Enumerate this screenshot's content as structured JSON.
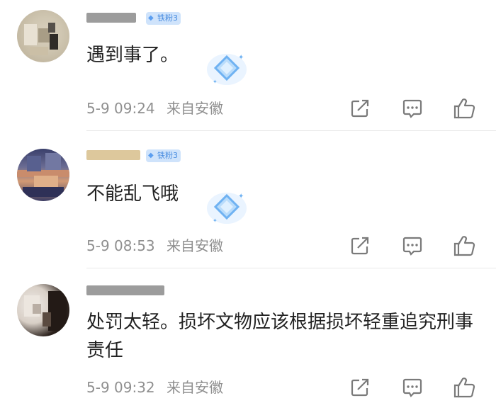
{
  "comments": [
    {
      "username": "",
      "fan_badge": "铁粉3",
      "text": "遇到事了。",
      "date": "5-9 09:24",
      "location": "来自安徽",
      "has_sticker": true
    },
    {
      "username": "",
      "fan_badge": "铁粉3",
      "text": "不能乱飞哦",
      "date": "5-9 08:53",
      "location": "来自安徽",
      "has_sticker": true
    },
    {
      "username": "",
      "fan_badge": "",
      "text": "处罚太轻。损坏文物应该根据损坏轻重追究刑事责任",
      "date": "5-9 09:32",
      "location": "来自安徽",
      "has_sticker": false
    }
  ],
  "icons": {
    "share": "share-icon",
    "reply": "comment-icon",
    "like": "thumbs-up-icon",
    "sticker": "diamond-sticker-icon"
  },
  "colors": {
    "meta_text": "#8f8f8f",
    "badge_bg": "#cfe3fb",
    "badge_text": "#4a8de0",
    "icon_gray": "#7a7a7a"
  }
}
